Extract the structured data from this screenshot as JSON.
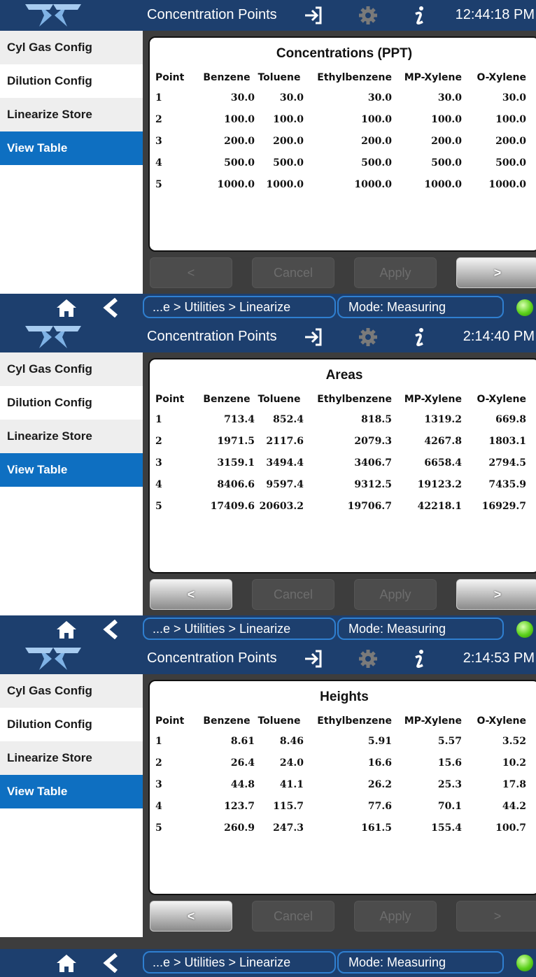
{
  "sidebar": {
    "items": [
      {
        "label": "Cyl Gas Config"
      },
      {
        "label": "Dilution Config"
      },
      {
        "label": "Linearize Store"
      },
      {
        "label": "View Table"
      }
    ]
  },
  "columns": [
    "Point",
    "Benzene",
    "Toluene",
    "Ethylbenzene",
    "MP-Xylene",
    "O-Xylene"
  ],
  "buttons": {
    "back": "<",
    "cancel": "Cancel",
    "apply": "Apply",
    "next": ">"
  },
  "breadcrumb": "...e > Utilities > Linearize",
  "mode": "Mode: Measuring",
  "screens": [
    {
      "title": "Concentration Points",
      "time": "12:44:18 PM",
      "table_title": "Concentrations (PPT)",
      "rows": [
        [
          "1",
          "30.0",
          "30.0",
          "30.0",
          "30.0",
          "30.0"
        ],
        [
          "2",
          "100.0",
          "100.0",
          "100.0",
          "100.0",
          "100.0"
        ],
        [
          "3",
          "200.0",
          "200.0",
          "200.0",
          "200.0",
          "200.0"
        ],
        [
          "4",
          "500.0",
          "500.0",
          "500.0",
          "500.0",
          "500.0"
        ],
        [
          "5",
          "1000.0",
          "1000.0",
          "1000.0",
          "1000.0",
          "1000.0"
        ]
      ],
      "back_enabled": false,
      "next_enabled": true
    },
    {
      "title": "Concentration Points",
      "time": "2:14:40 PM",
      "table_title": "Areas",
      "rows": [
        [
          "1",
          "713.4",
          "852.4",
          "818.5",
          "1319.2",
          "669.8"
        ],
        [
          "2",
          "1971.5",
          "2117.6",
          "2079.3",
          "4267.8",
          "1803.1"
        ],
        [
          "3",
          "3159.1",
          "3494.4",
          "3406.7",
          "6658.4",
          "2794.5"
        ],
        [
          "4",
          "8406.6",
          "9597.4",
          "9312.5",
          "19123.2",
          "7435.9"
        ],
        [
          "5",
          "17409.6",
          "20603.2",
          "19706.7",
          "42218.1",
          "16929.7"
        ]
      ],
      "back_enabled": true,
      "next_enabled": true
    },
    {
      "title": "Concentration Points",
      "time": "2:14:53 PM",
      "table_title": "Heights",
      "rows": [
        [
          "1",
          "8.61",
          "8.46",
          "5.91",
          "5.57",
          "3.52"
        ],
        [
          "2",
          "26.4",
          "24.0",
          "16.6",
          "15.6",
          "10.2"
        ],
        [
          "3",
          "44.8",
          "41.1",
          "26.2",
          "25.3",
          "17.8"
        ],
        [
          "4",
          "123.7",
          "115.7",
          "77.6",
          "70.1",
          "44.2"
        ],
        [
          "5",
          "260.9",
          "247.3",
          "161.5",
          "155.4",
          "100.7"
        ]
      ],
      "back_enabled": true,
      "next_enabled": false
    }
  ],
  "icons": [
    "company-logo-icon",
    "exit-icon",
    "gear-icon",
    "info-icon",
    "home-icon",
    "back-chevron-icon",
    "status-led-icon"
  ],
  "colors": {
    "header": "#1d3f6e",
    "active_item": "#0e6fc1",
    "status_led": "#5bd11b",
    "field_border": "#2f7fd0"
  }
}
